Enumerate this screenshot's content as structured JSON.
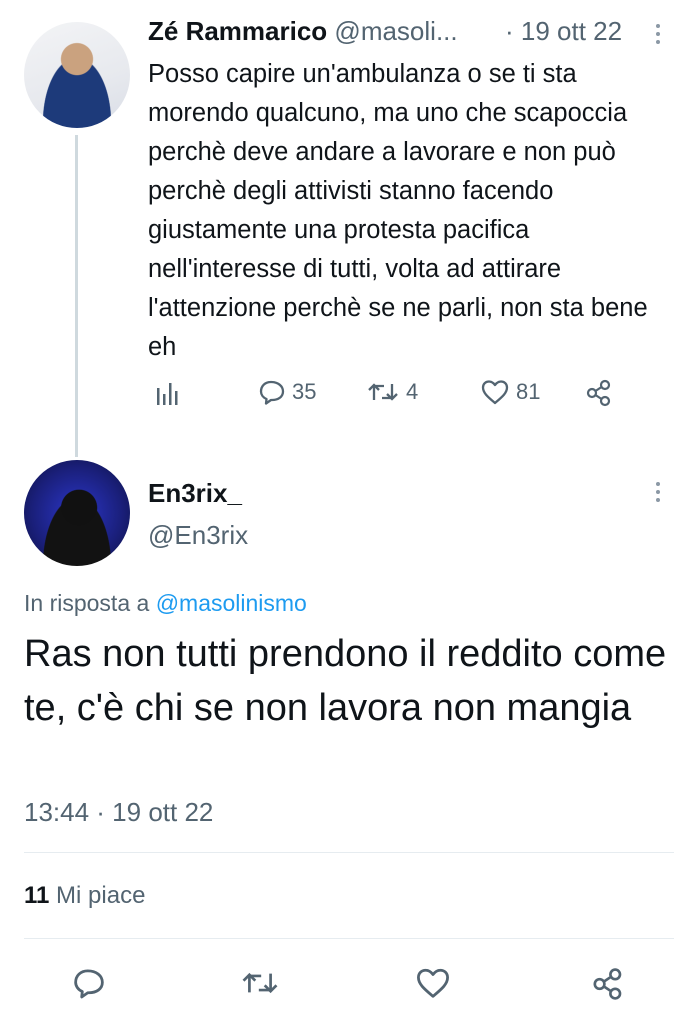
{
  "tweet1": {
    "display_name": "Zé Rammarico",
    "handle": "@masoli...",
    "time": "· 19 ott 22",
    "text": "Posso capire un'ambulanza o se ti sta morendo qualcuno, ma uno che scapoccia perchè deve andare a lavorare e non può perchè degli attivisti stanno facendo giustamente una protesta pacifica nell'interesse di tutti, volta ad attirare l'attenzione perchè se ne parli, non sta bene eh",
    "replies": "35",
    "retweets": "4",
    "likes": "81"
  },
  "tweet2": {
    "display_name": "En3rix_",
    "handle": "@En3rix",
    "reply_prefix": "In risposta a",
    "reply_mention": "@masolinismo",
    "text": "Ras non tutti prendono il reddito come te, c'è chi se non lavora non mangia",
    "timestamp": "13:44 · 19 ott 22",
    "likes_count": "11",
    "likes_label": "Mi piace"
  },
  "icons": {
    "analytics": "bar-chart-icon",
    "reply": "speech-bubble-icon",
    "retweet": "retweet-arrows-icon",
    "like": "heart-icon",
    "share": "share-nodes-icon",
    "more": "vertical-dots-icon"
  },
  "colors": {
    "link": "#1d9bf0",
    "muted": "#536471",
    "text": "#0f1419"
  }
}
